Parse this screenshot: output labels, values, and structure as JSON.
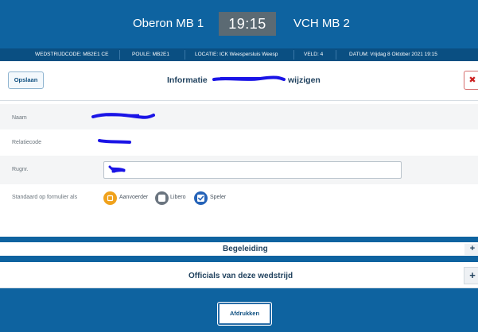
{
  "header": {
    "home_team": "Oberon MB 1",
    "clock": "19:15",
    "away_team": "VCH MB 2"
  },
  "match_info": {
    "wedstrijdcode": "WEDSTRIJDCODE: MB2E1 CE",
    "poule": "POULE: MB2E1",
    "locatie": "LOCATIE: ICK Weespersluis Weesp",
    "veld": "VELD: 4",
    "datum": "DATUM: Vrijdag 8 Oktober 2021 19:15"
  },
  "toolbar": {
    "save_label": "Opslaan",
    "title_prefix": "Informatie",
    "title_suffix": "wijzigen",
    "close_label": "✖"
  },
  "form": {
    "naam_label": "Naam",
    "relatiecode_label": "Relatiecode",
    "rugnr_label": "Rugnr.",
    "rugnr_value": "",
    "standaard_label": "Standaard op formulier als",
    "options": {
      "aanvoerder": "Aanvoerder",
      "libero": "Libero",
      "speler": "Speler"
    }
  },
  "sections": {
    "begeleiding": "Begeleiding",
    "officials": "Officials van deze wedstrijd",
    "plus": "+"
  },
  "footer": {
    "print_label": "Afdrukken"
  },
  "colors": {
    "header_blue": "#0e63a0",
    "info_strip": "#0a4f82",
    "clock_bg": "#5b6a73",
    "aanvoerder_orange": "#f0a21c",
    "checkbox_blue": "#2563b8",
    "redaction_blue": "#1a14e6"
  }
}
